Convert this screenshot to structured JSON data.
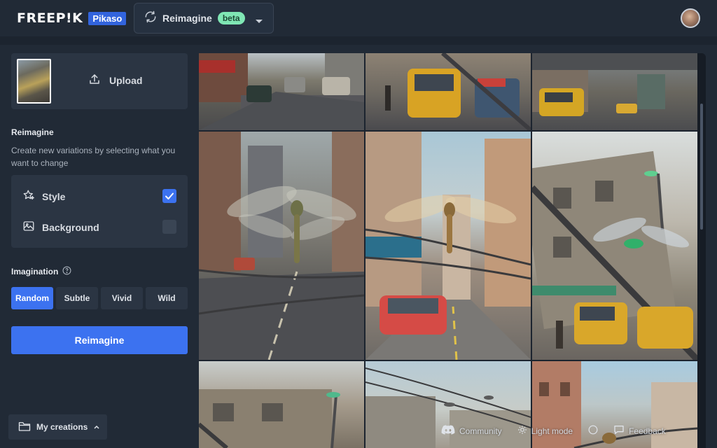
{
  "header": {
    "logo_text": "FREEP!K",
    "logo_badge": "Pikaso",
    "tool_name": "Reimagine",
    "tool_badge": "beta"
  },
  "panel": {
    "upload_label": "Upload",
    "section_title": "Reimagine",
    "section_description": "Create new variations by selecting what you want to change",
    "options": [
      {
        "label": "Style",
        "checked": true
      },
      {
        "label": "Background",
        "checked": false
      }
    ],
    "imagination_label": "Imagination",
    "imagination_levels": [
      "Random",
      "Subtle",
      "Vivid",
      "Wild"
    ],
    "imagination_selected": "Random",
    "submit_label": "Reimagine",
    "my_creations_label": "My creations"
  },
  "footer": {
    "community": "Community",
    "light_mode": "Light mode",
    "feedback": "Feedback"
  },
  "colors": {
    "accent": "#3c72f0",
    "background": "#212a36",
    "card": "#2b3543",
    "beta_badge": "#7fe6b4"
  }
}
